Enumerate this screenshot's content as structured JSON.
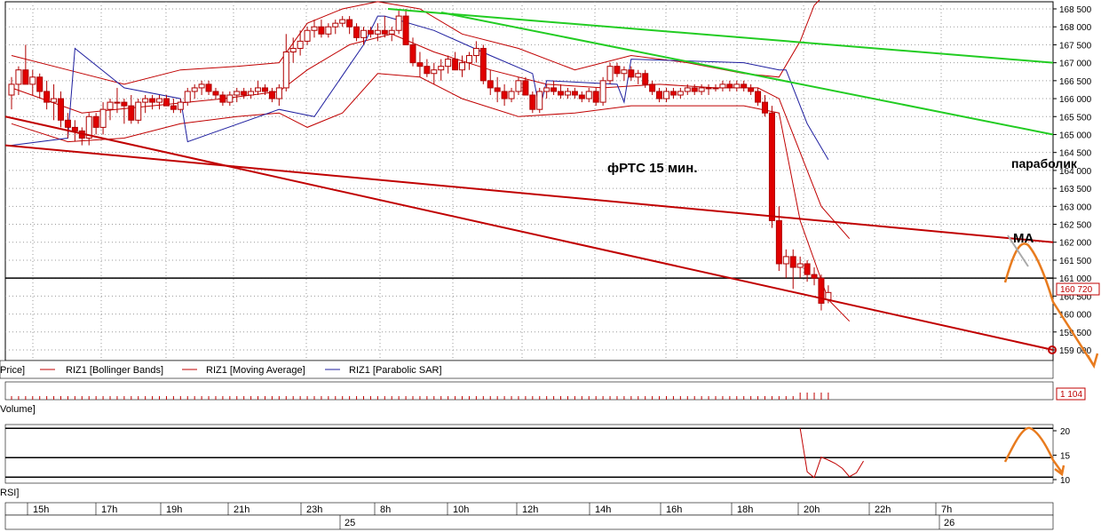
{
  "chart_data": {
    "type": "candlestick",
    "title": "фРТС  15 мин.",
    "price_axis": {
      "min": 158.8,
      "max": 168.6,
      "ticks": [
        "168 500",
        "168 000",
        "167 500",
        "167 000",
        "166 500",
        "166 000",
        "165 500",
        "165 000",
        "164 500",
        "164 000",
        "163 500",
        "163 000",
        "162 500",
        "162 000",
        "161 500",
        "161 000",
        "160 500",
        "160 000",
        "159 500",
        "159 000"
      ],
      "tick_values": [
        168.5,
        168.0,
        167.5,
        167.0,
        166.5,
        166.0,
        165.5,
        165.0,
        164.5,
        164.0,
        163.5,
        163.0,
        162.5,
        162.0,
        161.5,
        161.0,
        160.5,
        160.0,
        159.5,
        159.0
      ],
      "last_price_label": "160 720",
      "last_price": 160.72,
      "horizontal_line": 161.0
    },
    "legend": [
      {
        "label": "Price]",
        "color": "#000000"
      },
      {
        "label": "RIZ1 [Bollinger Bands]",
        "color": "#c00000"
      },
      {
        "label": "RIZ1 [Moving Average]",
        "color": "#c00000"
      },
      {
        "label": "RIZ1 [Parabolic SAR]",
        "color": "#1f1f9f"
      }
    ],
    "candles": [
      {
        "o": 166.1,
        "h": 166.6,
        "l": 165.7,
        "c": 166.4
      },
      {
        "o": 166.4,
        "h": 166.9,
        "l": 166.1,
        "c": 166.8
      },
      {
        "o": 166.8,
        "h": 167.5,
        "l": 166.5,
        "c": 166.4
      },
      {
        "o": 166.4,
        "h": 166.8,
        "l": 166.1,
        "c": 166.6
      },
      {
        "o": 166.6,
        "h": 166.7,
        "l": 166.0,
        "c": 166.2
      },
      {
        "o": 166.2,
        "h": 166.5,
        "l": 165.7,
        "c": 165.9
      },
      {
        "o": 165.9,
        "h": 166.4,
        "l": 165.4,
        "c": 166.0
      },
      {
        "o": 166.0,
        "h": 166.2,
        "l": 165.2,
        "c": 165.4
      },
      {
        "o": 165.4,
        "h": 165.6,
        "l": 164.9,
        "c": 165.2
      },
      {
        "o": 165.2,
        "h": 165.4,
        "l": 164.8,
        "c": 165.1
      },
      {
        "o": 165.1,
        "h": 165.2,
        "l": 164.7,
        "c": 164.9
      },
      {
        "o": 164.9,
        "h": 165.6,
        "l": 164.7,
        "c": 165.5
      },
      {
        "o": 165.5,
        "h": 165.6,
        "l": 165.0,
        "c": 165.2
      },
      {
        "o": 165.2,
        "h": 165.9,
        "l": 165.0,
        "c": 165.7
      },
      {
        "o": 165.7,
        "h": 166.0,
        "l": 165.4,
        "c": 165.9
      },
      {
        "o": 165.9,
        "h": 166.3,
        "l": 165.6,
        "c": 165.9
      },
      {
        "o": 165.9,
        "h": 166.0,
        "l": 165.3,
        "c": 165.8
      },
      {
        "o": 165.8,
        "h": 166.1,
        "l": 165.3,
        "c": 165.4
      },
      {
        "o": 165.4,
        "h": 166.0,
        "l": 165.3,
        "c": 165.9
      },
      {
        "o": 165.9,
        "h": 166.1,
        "l": 165.6,
        "c": 166.0
      },
      {
        "o": 166.0,
        "h": 166.1,
        "l": 165.7,
        "c": 165.9
      },
      {
        "o": 165.9,
        "h": 166.1,
        "l": 165.7,
        "c": 166.0
      },
      {
        "o": 166.0,
        "h": 166.1,
        "l": 165.8,
        "c": 165.8
      },
      {
        "o": 165.8,
        "h": 166.0,
        "l": 165.6,
        "c": 165.7
      },
      {
        "o": 165.7,
        "h": 166.0,
        "l": 165.6,
        "c": 165.9
      },
      {
        "o": 165.9,
        "h": 166.3,
        "l": 165.8,
        "c": 166.2
      },
      {
        "o": 166.2,
        "h": 166.4,
        "l": 166.0,
        "c": 166.3
      },
      {
        "o": 166.3,
        "h": 166.5,
        "l": 166.1,
        "c": 166.4
      },
      {
        "o": 166.4,
        "h": 166.5,
        "l": 166.1,
        "c": 166.2
      },
      {
        "o": 166.2,
        "h": 166.3,
        "l": 166.0,
        "c": 166.1
      },
      {
        "o": 166.1,
        "h": 166.2,
        "l": 165.8,
        "c": 165.9
      },
      {
        "o": 165.9,
        "h": 166.2,
        "l": 165.8,
        "c": 166.1
      },
      {
        "o": 166.1,
        "h": 166.3,
        "l": 165.9,
        "c": 166.2
      },
      {
        "o": 166.2,
        "h": 166.3,
        "l": 166.0,
        "c": 166.1
      },
      {
        "o": 166.1,
        "h": 166.3,
        "l": 166.0,
        "c": 166.2
      },
      {
        "o": 166.2,
        "h": 166.5,
        "l": 166.1,
        "c": 166.3
      },
      {
        "o": 166.3,
        "h": 166.4,
        "l": 166.1,
        "c": 166.2
      },
      {
        "o": 166.2,
        "h": 166.3,
        "l": 165.9,
        "c": 166.0
      },
      {
        "o": 166.0,
        "h": 166.4,
        "l": 165.8,
        "c": 166.3
      },
      {
        "o": 166.3,
        "h": 167.8,
        "l": 166.2,
        "c": 167.3
      },
      {
        "o": 167.3,
        "h": 167.7,
        "l": 167.0,
        "c": 167.4
      },
      {
        "o": 167.4,
        "h": 167.9,
        "l": 167.2,
        "c": 167.6
      },
      {
        "o": 167.6,
        "h": 168.0,
        "l": 167.5,
        "c": 167.9
      },
      {
        "o": 167.9,
        "h": 168.2,
        "l": 167.7,
        "c": 168.0
      },
      {
        "o": 168.0,
        "h": 168.2,
        "l": 167.7,
        "c": 167.8
      },
      {
        "o": 167.8,
        "h": 168.1,
        "l": 167.7,
        "c": 168.0
      },
      {
        "o": 168.0,
        "h": 168.2,
        "l": 167.8,
        "c": 168.1
      },
      {
        "o": 168.1,
        "h": 168.3,
        "l": 168.0,
        "c": 168.2
      },
      {
        "o": 168.2,
        "h": 168.3,
        "l": 167.8,
        "c": 168.0
      },
      {
        "o": 168.0,
        "h": 168.1,
        "l": 167.6,
        "c": 167.7
      },
      {
        "o": 167.7,
        "h": 168.0,
        "l": 167.5,
        "c": 167.9
      },
      {
        "o": 167.9,
        "h": 168.0,
        "l": 167.7,
        "c": 167.8
      },
      {
        "o": 167.8,
        "h": 168.1,
        "l": 167.6,
        "c": 167.9
      },
      {
        "o": 167.9,
        "h": 168.3,
        "l": 167.7,
        "c": 167.8
      },
      {
        "o": 167.8,
        "h": 168.0,
        "l": 167.6,
        "c": 167.9
      },
      {
        "o": 167.9,
        "h": 168.5,
        "l": 167.8,
        "c": 168.3
      },
      {
        "o": 168.3,
        "h": 168.5,
        "l": 167.6,
        "c": 167.5
      },
      {
        "o": 167.5,
        "h": 167.7,
        "l": 166.9,
        "c": 167.0
      },
      {
        "o": 167.0,
        "h": 167.3,
        "l": 166.6,
        "c": 166.9
      },
      {
        "o": 166.9,
        "h": 167.1,
        "l": 166.6,
        "c": 166.7
      },
      {
        "o": 166.7,
        "h": 167.0,
        "l": 166.4,
        "c": 166.8
      },
      {
        "o": 166.8,
        "h": 167.1,
        "l": 166.5,
        "c": 166.9
      },
      {
        "o": 166.9,
        "h": 167.2,
        "l": 166.7,
        "c": 167.1
      },
      {
        "o": 167.1,
        "h": 167.3,
        "l": 166.8,
        "c": 166.8
      },
      {
        "o": 166.8,
        "h": 167.2,
        "l": 166.6,
        "c": 167.0
      },
      {
        "o": 167.0,
        "h": 167.3,
        "l": 166.8,
        "c": 167.2
      },
      {
        "o": 167.2,
        "h": 167.6,
        "l": 167.0,
        "c": 167.4
      },
      {
        "o": 167.4,
        "h": 167.5,
        "l": 166.4,
        "c": 166.5
      },
      {
        "o": 166.5,
        "h": 166.8,
        "l": 166.1,
        "c": 166.3
      },
      {
        "o": 166.3,
        "h": 166.6,
        "l": 165.9,
        "c": 166.2
      },
      {
        "o": 166.2,
        "h": 166.4,
        "l": 165.8,
        "c": 166.0
      },
      {
        "o": 166.0,
        "h": 166.3,
        "l": 165.9,
        "c": 166.2
      },
      {
        "o": 166.2,
        "h": 166.6,
        "l": 166.1,
        "c": 166.5
      },
      {
        "o": 166.5,
        "h": 166.6,
        "l": 166.1,
        "c": 166.1
      },
      {
        "o": 166.1,
        "h": 166.2,
        "l": 165.6,
        "c": 165.7
      },
      {
        "o": 165.7,
        "h": 166.3,
        "l": 165.6,
        "c": 166.2
      },
      {
        "o": 166.2,
        "h": 166.4,
        "l": 166.0,
        "c": 166.3
      },
      {
        "o": 166.3,
        "h": 166.5,
        "l": 166.1,
        "c": 166.2
      },
      {
        "o": 166.2,
        "h": 166.4,
        "l": 166.0,
        "c": 166.1
      },
      {
        "o": 166.1,
        "h": 166.3,
        "l": 166.0,
        "c": 166.2
      },
      {
        "o": 166.2,
        "h": 166.3,
        "l": 166.0,
        "c": 166.1
      },
      {
        "o": 166.1,
        "h": 166.2,
        "l": 165.9,
        "c": 166.0
      },
      {
        "o": 166.0,
        "h": 166.3,
        "l": 165.9,
        "c": 166.2
      },
      {
        "o": 166.2,
        "h": 166.3,
        "l": 165.8,
        "c": 165.9
      },
      {
        "o": 165.9,
        "h": 166.6,
        "l": 165.8,
        "c": 166.5
      },
      {
        "o": 166.5,
        "h": 167.0,
        "l": 166.4,
        "c": 166.9
      },
      {
        "o": 166.9,
        "h": 167.0,
        "l": 166.6,
        "c": 166.7
      },
      {
        "o": 166.7,
        "h": 166.9,
        "l": 166.5,
        "c": 166.8
      },
      {
        "o": 166.8,
        "h": 166.9,
        "l": 166.5,
        "c": 166.6
      },
      {
        "o": 166.6,
        "h": 166.8,
        "l": 166.4,
        "c": 166.7
      },
      {
        "o": 166.7,
        "h": 166.8,
        "l": 166.3,
        "c": 166.4
      },
      {
        "o": 166.4,
        "h": 166.5,
        "l": 166.1,
        "c": 166.2
      },
      {
        "o": 166.2,
        "h": 166.3,
        "l": 165.9,
        "c": 166.0
      },
      {
        "o": 166.0,
        "h": 166.3,
        "l": 165.9,
        "c": 166.2
      },
      {
        "o": 166.2,
        "h": 166.3,
        "l": 166.0,
        "c": 166.1
      },
      {
        "o": 166.1,
        "h": 166.3,
        "l": 166.0,
        "c": 166.2
      },
      {
        "o": 166.2,
        "h": 166.4,
        "l": 166.1,
        "c": 166.3
      },
      {
        "o": 166.3,
        "h": 166.4,
        "l": 166.1,
        "c": 166.2
      },
      {
        "o": 166.2,
        "h": 166.4,
        "l": 166.1,
        "c": 166.3
      },
      {
        "o": 166.3,
        "h": 166.4,
        "l": 166.1,
        "c": 166.3
      },
      {
        "o": 166.3,
        "h": 166.4,
        "l": 166.2,
        "c": 166.3
      },
      {
        "o": 166.3,
        "h": 166.5,
        "l": 166.2,
        "c": 166.4
      },
      {
        "o": 166.4,
        "h": 166.5,
        "l": 166.2,
        "c": 166.3
      },
      {
        "o": 166.3,
        "h": 166.5,
        "l": 166.2,
        "c": 166.4
      },
      {
        "o": 166.4,
        "h": 166.5,
        "l": 166.2,
        "c": 166.3
      },
      {
        "o": 166.3,
        "h": 166.4,
        "l": 166.1,
        "c": 166.2
      },
      {
        "o": 166.2,
        "h": 166.3,
        "l": 165.8,
        "c": 165.9
      },
      {
        "o": 165.9,
        "h": 166.1,
        "l": 165.5,
        "c": 165.6
      },
      {
        "o": 165.6,
        "h": 165.8,
        "l": 162.4,
        "c": 162.6
      },
      {
        "o": 162.6,
        "h": 163.0,
        "l": 161.2,
        "c": 161.4
      },
      {
        "o": 161.4,
        "h": 161.8,
        "l": 161.0,
        "c": 161.6
      },
      {
        "o": 161.6,
        "h": 161.8,
        "l": 160.7,
        "c": 161.3
      },
      {
        "o": 161.3,
        "h": 161.6,
        "l": 161.0,
        "c": 161.4
      },
      {
        "o": 161.4,
        "h": 161.5,
        "l": 160.9,
        "c": 161.1
      },
      {
        "o": 161.1,
        "h": 161.3,
        "l": 160.8,
        "c": 161.0
      },
      {
        "o": 161.0,
        "h": 161.1,
        "l": 160.1,
        "c": 160.3
      },
      {
        "o": 160.4,
        "h": 160.8,
        "l": 160.3,
        "c": 160.6
      }
    ],
    "bollinger_upper": [
      [
        0,
        167.2
      ],
      [
        8,
        166.8
      ],
      [
        16,
        166.4
      ],
      [
        24,
        166.8
      ],
      [
        32,
        166.9
      ],
      [
        38,
        167.0
      ],
      [
        42,
        168.1
      ],
      [
        47,
        168.5
      ],
      [
        52,
        168.7
      ],
      [
        58,
        168.5
      ],
      [
        64,
        167.8
      ],
      [
        72,
        167.4
      ],
      [
        80,
        166.8
      ],
      [
        88,
        167.2
      ],
      [
        96,
        167.0
      ],
      [
        104,
        166.7
      ],
      [
        109,
        166.6
      ],
      [
        112,
        167.6
      ],
      [
        114,
        168.6
      ],
      [
        115,
        168.8
      ]
    ],
    "bollinger_lower": [
      [
        0,
        165.3
      ],
      [
        8,
        164.8
      ],
      [
        16,
        164.9
      ],
      [
        24,
        165.3
      ],
      [
        32,
        165.5
      ],
      [
        38,
        165.6
      ],
      [
        42,
        165.2
      ],
      [
        47,
        165.6
      ],
      [
        52,
        166.7
      ],
      [
        58,
        166.6
      ],
      [
        64,
        166.0
      ],
      [
        72,
        165.5
      ],
      [
        80,
        165.6
      ],
      [
        88,
        165.8
      ],
      [
        96,
        165.8
      ],
      [
        104,
        165.8
      ],
      [
        109,
        165.6
      ],
      [
        112,
        162.6
      ],
      [
        116,
        160.4
      ],
      [
        119,
        159.8
      ]
    ],
    "moving_average": [
      [
        0,
        166.3
      ],
      [
        10,
        165.6
      ],
      [
        20,
        165.8
      ],
      [
        30,
        166.0
      ],
      [
        38,
        166.2
      ],
      [
        42,
        166.8
      ],
      [
        48,
        167.5
      ],
      [
        54,
        167.8
      ],
      [
        60,
        167.3
      ],
      [
        68,
        166.8
      ],
      [
        76,
        166.4
      ],
      [
        84,
        166.3
      ],
      [
        92,
        166.4
      ],
      [
        100,
        166.3
      ],
      [
        106,
        166.3
      ],
      [
        109,
        166.0
      ],
      [
        112,
        164.5
      ],
      [
        115,
        163.0
      ],
      [
        119,
        162.1
      ]
    ],
    "parabolic_sar": [
      [
        [
          0,
          164.7
        ],
        [
          8,
          164.9
        ]
      ],
      [
        [
          9,
          167.4
        ],
        [
          16,
          166.3
        ],
        [
          24,
          166.0
        ]
      ],
      [
        [
          25,
          164.8
        ],
        [
          38,
          165.7
        ],
        [
          43,
          165.5
        ],
        [
          50,
          167.5
        ],
        [
          52,
          168.3
        ]
      ],
      [
        [
          53,
          168.3
        ],
        [
          60,
          167.9
        ],
        [
          68,
          167.2
        ],
        [
          74,
          166.7
        ],
        [
          75,
          165.7
        ]
      ],
      [
        [
          76,
          166.5
        ],
        [
          86,
          166.4
        ]
      ],
      [
        [
          87,
          165.9
        ]
      ],
      [
        [
          88,
          167.1
        ],
        [
          104,
          167.0
        ],
        [
          109,
          166.8
        ]
      ],
      [
        [
          110,
          166.8
        ],
        [
          113,
          165.3
        ],
        [
          116,
          164.3
        ]
      ]
    ],
    "trendlines": [
      {
        "color": "#22cc22",
        "from": [
          0.0,
          168.5
        ],
        "to": [
          1.0,
          167.0
        ],
        "note": "upper green"
      },
      {
        "color": "#22cc22",
        "from": [
          0.0,
          168.4
        ],
        "to": [
          1.0,
          165.0
        ],
        "note": "lower green"
      },
      {
        "color": "#c00000",
        "from": [
          0.0,
          164.7
        ],
        "to": [
          1.0,
          162.0
        ],
        "note": "red upper"
      },
      {
        "color": "#c00000",
        "from": [
          0.0,
          165.5
        ],
        "to": [
          1.0,
          159.0
        ],
        "note": "red lower"
      }
    ],
    "forecast": {
      "color": "#e87b1e",
      "label_ma": "MA",
      "label_sar": "параболик"
    },
    "volume": {
      "label": "Volume]",
      "last_value": "1 104"
    },
    "rsi": {
      "label": "RSI]",
      "ticks": [
        "20",
        "15",
        "10"
      ],
      "tick_values": [
        20,
        15,
        10
      ],
      "min": 9,
      "max": 21,
      "levels": [
        20.5,
        14.5,
        10.5
      ],
      "values": [
        [
          112,
          20.5
        ],
        [
          113,
          11.6
        ],
        [
          114,
          10.4
        ],
        [
          115,
          14.6
        ],
        [
          116,
          14.0
        ],
        [
          117,
          13.3
        ],
        [
          118,
          12.3
        ],
        [
          119,
          10.6
        ],
        [
          120,
          11.4
        ],
        [
          121,
          13.8
        ]
      ]
    },
    "time_axis": {
      "hours": [
        "15h",
        "17h",
        "19h",
        "21h",
        "23h",
        "8h",
        "10h",
        "12h",
        "14h",
        "16h",
        "18h",
        "20h",
        "22h",
        "7h"
      ],
      "days": [
        "25",
        "26"
      ]
    }
  }
}
